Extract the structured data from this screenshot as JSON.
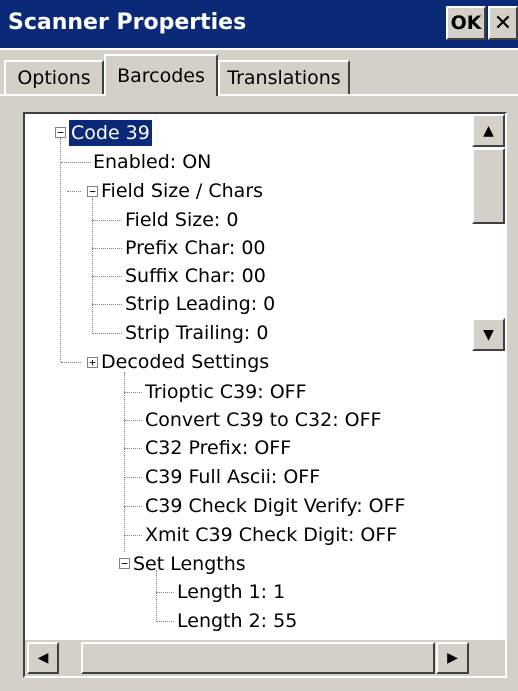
{
  "window": {
    "title": "Scanner Properties",
    "ok_label": "OK",
    "close_label": "✕"
  },
  "tabs": [
    {
      "label": "Options"
    },
    {
      "label": "Barcodes"
    },
    {
      "label": "Translations"
    }
  ],
  "tree": {
    "root": "Code 39",
    "enabled": "Enabled: ON",
    "field_size_group": "Field Size / Chars",
    "field_size": "Field Size: 0",
    "prefix_char": "Prefix Char: 00",
    "suffix_char": "Suffix Char: 00",
    "strip_leading": "Strip Leading: 0",
    "strip_trailing": "Strip Trailing: 0",
    "decoded_settings": "Decoded Settings",
    "trioptic": "Trioptic C39: OFF",
    "convert_c39_c32": "Convert C39 to C32: OFF",
    "c32_prefix": "C32 Prefix: OFF",
    "c39_full_ascii": "C39 Full Ascii: OFF",
    "c39_check_verify": "C39 Check Digit Verify: OFF",
    "xmit_check_digit": "Xmit C39 Check Digit: OFF",
    "set_lengths": "Set Lengths",
    "length1": "Length 1: 1",
    "length2": "Length 2: 55"
  },
  "expanders": {
    "minus": "−",
    "plus": "+"
  },
  "scroll": {
    "up": "▲",
    "down": "▼",
    "left": "◀",
    "right": "▶"
  }
}
